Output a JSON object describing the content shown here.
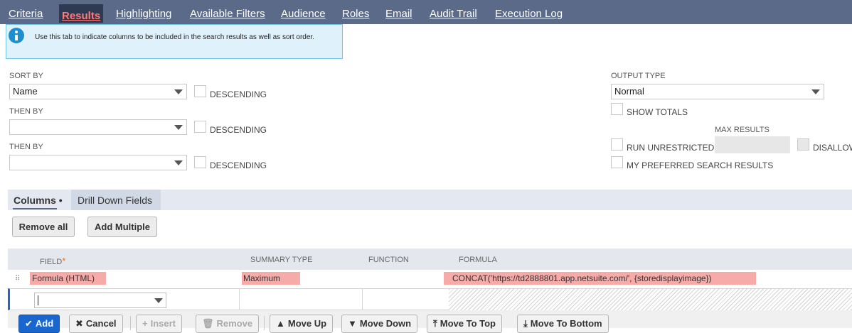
{
  "tabs": [
    {
      "label": "Criteria"
    },
    {
      "label": "Results",
      "active": true
    },
    {
      "label": "Highlighting"
    },
    {
      "label": "Available Filters"
    },
    {
      "label": "Audience"
    },
    {
      "label": "Roles"
    },
    {
      "label": "Email"
    },
    {
      "label": "Audit Trail"
    },
    {
      "label": "Execution Log"
    }
  ],
  "info": {
    "icon": "info-icon",
    "text": "Use this tab to indicate columns to be included in the search results as well as sort order."
  },
  "sort": {
    "sort_by_label": "SORT BY",
    "sort_by_value": "Name",
    "then_by_label_1": "THEN BY",
    "then_by_value_1": "",
    "then_by_label_2": "THEN BY",
    "then_by_value_2": "",
    "descending_label": "DESCENDING"
  },
  "output": {
    "output_type_label": "OUTPUT TYPE",
    "output_type_value": "Normal",
    "show_totals_label": "SHOW TOTALS",
    "max_results_label": "MAX RESULTS",
    "run_unrestricted_label": "RUN UNRESTRICTED",
    "disallow_label": "DISALLOW",
    "my_preferred_label": "MY PREFERRED SEARCH RESULTS"
  },
  "subtabs": {
    "columns": "Columns",
    "columns_dot": "•",
    "drill_down": "Drill Down Fields"
  },
  "buttons": {
    "remove_all": "Remove all",
    "add_multiple": "Add Multiple"
  },
  "grid": {
    "headers": {
      "field": "FIELD",
      "required_mark": "*",
      "summary_type": "SUMMARY TYPE",
      "function": "FUNCTION",
      "formula": "FORMULA"
    },
    "rows": [
      {
        "field": "Formula (HTML)",
        "summary_type": "Maximum",
        "function": "",
        "formula": "CONCAT('https://td2888801.app.netsuite.com/', {storedisplayimage})"
      }
    ]
  },
  "row_actions": {
    "add": "Add",
    "cancel": "Cancel",
    "insert": "Insert",
    "remove": "Remove",
    "move_up": "Move Up",
    "move_down": "Move Down",
    "move_to_top": "Move To Top",
    "move_to_bottom": "Move To Bottom"
  },
  "colors": {
    "tabbar": "#5b6a89",
    "active_tab_text": "#ff7a78",
    "highlight": "#f7aba9",
    "primary_button": "#1a66cf",
    "info_bg": "#dff1fb"
  }
}
